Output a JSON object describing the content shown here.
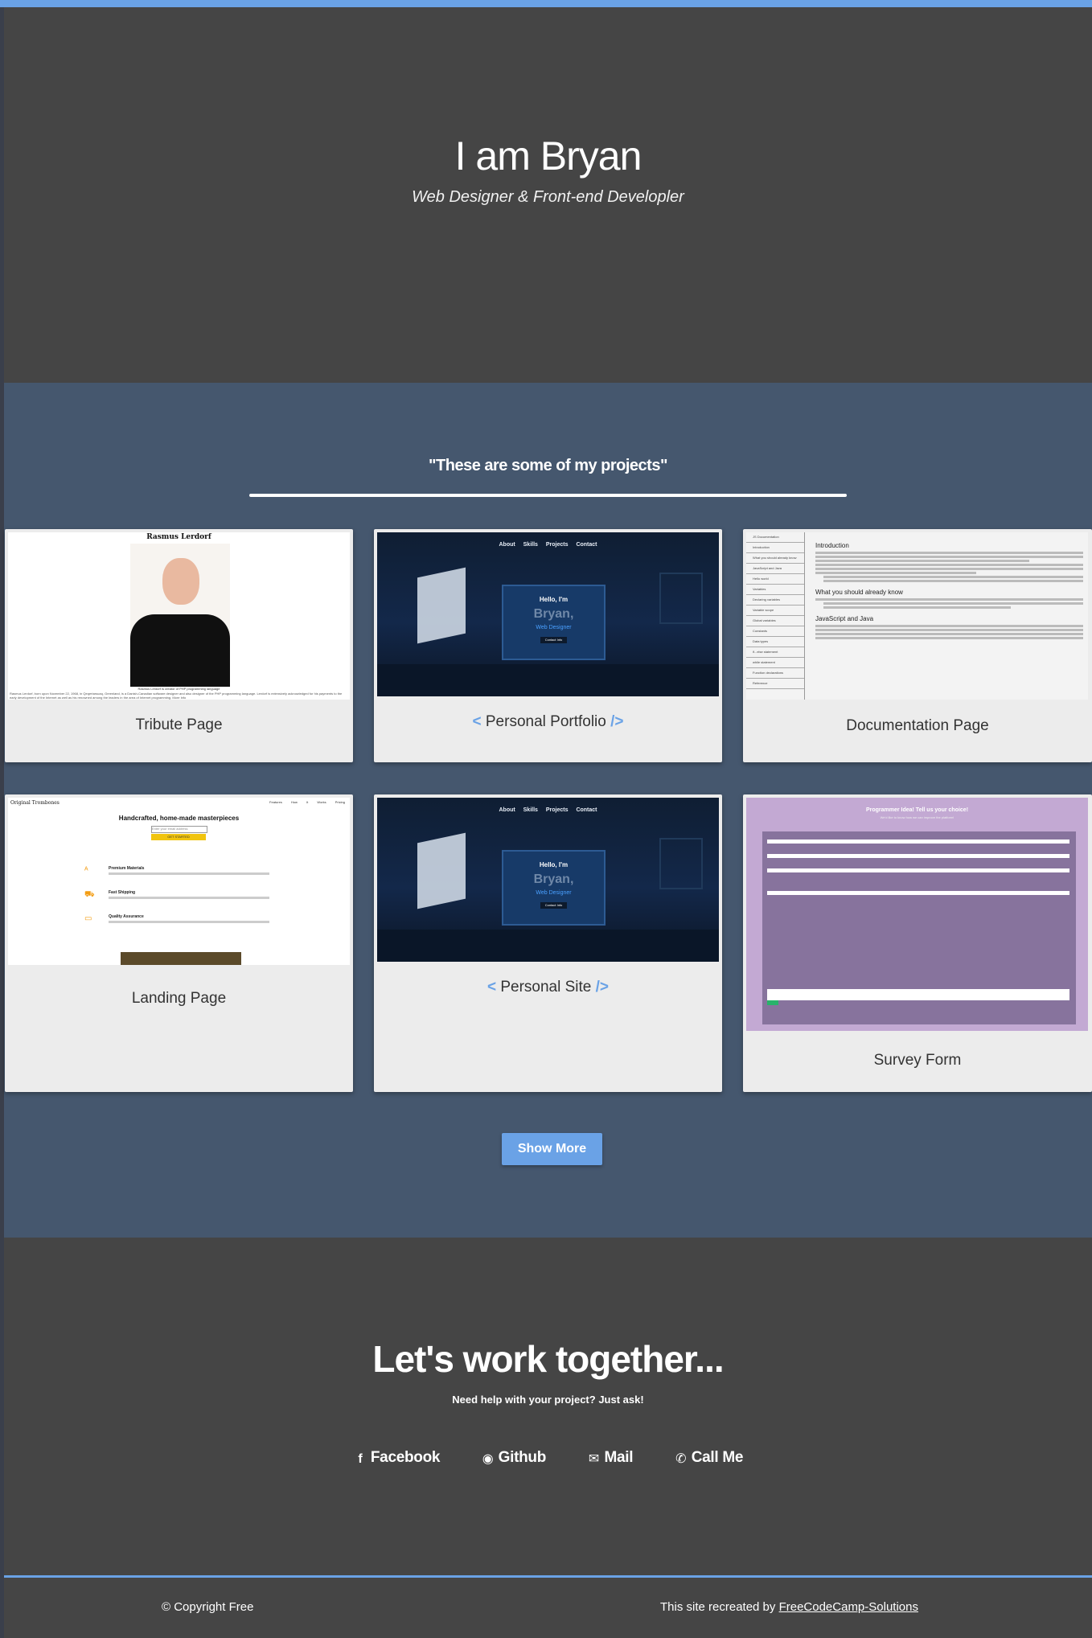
{
  "hero": {
    "title": "I am Bryan",
    "subtitle": "Web Designer & Front-end Developler"
  },
  "projects": {
    "heading": "\"These are some of my projects\"",
    "cards": [
      {
        "label": "Tribute Page"
      },
      {
        "label_open": "<",
        "label": "Personal Portfolio",
        "label_close": "/>"
      },
      {
        "label": "Documentation Page"
      },
      {
        "label": "Landing Page"
      },
      {
        "label_open": "<",
        "label": "Personal Site",
        "label_close": "/>"
      },
      {
        "label": "Survey Form"
      }
    ],
    "thumbs": {
      "tribute": {
        "title": "Rasmus Lerdorf",
        "caption": "Rasmus Lerdorf is creator of PHP programming language",
        "text": "Rasmus Lerdorf, born upon November 22, 1968, in Qeqertarsuaq, Greenland, is a Danish-Canadian software designer and also designer of the PHP programming language. Lerdorf is extensively acknowledged for his payments to the early development of the Internet as well as his renowned among the leaders in the area of Internet programming. More Info"
      },
      "room": {
        "nav": "About Skills Projects Contact",
        "hello": "Hello, I'm",
        "name": "Bryan,",
        "role": "Web Designer",
        "button": "Contact Info"
      },
      "doc": {
        "sidebar_title": "JS Documentation",
        "sidebar": [
          "Introduction",
          "What you should already know",
          "JavaScript and Java",
          "Hello world",
          "Variables",
          "Declaring variables",
          "Variable scope",
          "Global variables",
          "Constants",
          "Data types",
          "if...else statement",
          "while statement",
          "Function declarations",
          "Reference"
        ],
        "h_intro": "Introduction",
        "h_know": "What you should already know",
        "h_java": "JavaScript and Java"
      },
      "landing": {
        "logo": "Original Trombones",
        "links": "Features How It Works Pricing",
        "headline": "Handcrafted, home-made masterpieces",
        "email_placeholder": "Enter your email address",
        "cta": "GET STARTED",
        "features": [
          "Premium Materials",
          "Fast Shipping",
          "Quality Assurance"
        ]
      },
      "survey": {
        "title": "Programmer Idea! Tell us your choice!",
        "subtitle": "We'd like to know how we can improve the platform!"
      }
    },
    "show_more": "Show More"
  },
  "contact": {
    "title": "Let's work together...",
    "subtitle": "Need help with your project? Just ask!",
    "links": [
      {
        "icon": "facebook-icon",
        "glyph": "f",
        "label": "Facebook"
      },
      {
        "icon": "github-icon",
        "glyph": "◉",
        "label": "Github"
      },
      {
        "icon": "mail-icon",
        "glyph": "✉",
        "label": "Mail"
      },
      {
        "icon": "phone-icon",
        "glyph": "✆",
        "label": "Call Me"
      }
    ]
  },
  "footer": {
    "copyright": "© Copyright Free",
    "credit_prefix": "This site recreated by ",
    "credit_link": "FreeCodeCamp-Solutions"
  },
  "colors": {
    "accent": "#6aa2e6",
    "header_bg": "#454545",
    "projects_bg": "#45576e",
    "card_bg": "#ececec"
  }
}
